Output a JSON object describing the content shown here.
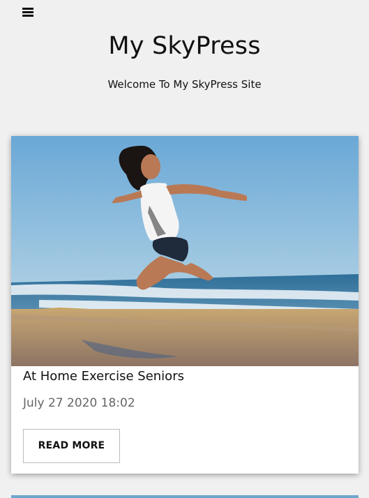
{
  "header": {
    "menu_icon": "hamburger-menu-icon",
    "site_title": "My SkyPress",
    "tagline": "Welcome To My SkyPress Site"
  },
  "posts": [
    {
      "title": "At Home Exercise Seniors",
      "date": "July 27 2020 18:02",
      "read_more_label": "READ MORE"
    }
  ],
  "colors": {
    "page_background": "#f0f0f0",
    "card_background": "#ffffff",
    "text_primary": "#111111",
    "text_muted": "#666666",
    "sky_blue": "#6fa7cf"
  }
}
